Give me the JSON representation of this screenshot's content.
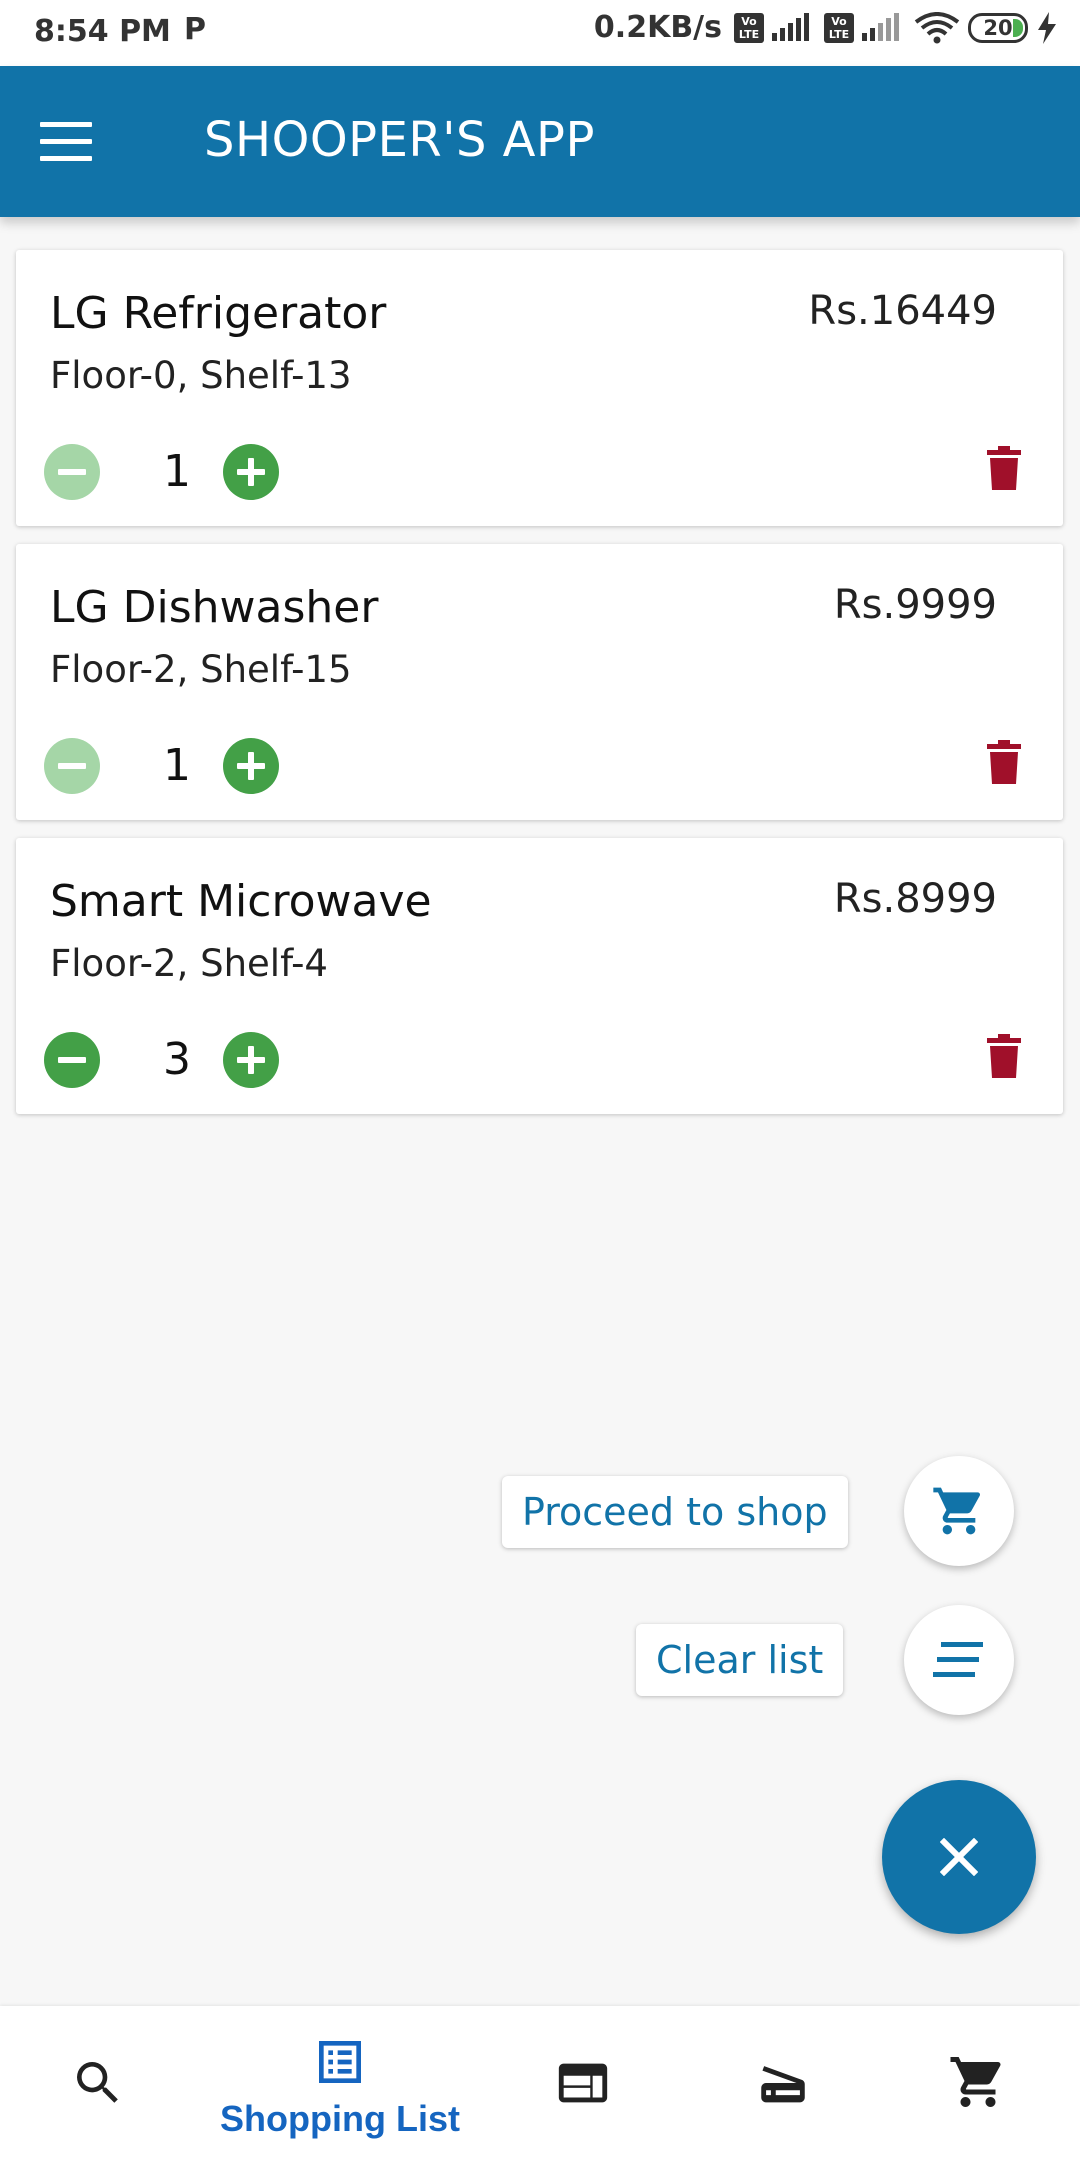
{
  "status_bar": {
    "time": "8:54 PM",
    "notification_icon": "P",
    "net_speed": "0.2KB/s",
    "volte_label_top": "Vo",
    "volte_label_bottom": "LTE",
    "battery": "20"
  },
  "app_bar": {
    "title": "SHOOPER'S APP",
    "menu_icon": "hamburger-menu-icon",
    "color": "#1173a8"
  },
  "items": [
    {
      "name": "LG Refrigerator",
      "location": "Floor-0, Shelf-13",
      "price": "Rs.16449",
      "quantity": "1"
    },
    {
      "name": "LG Dishwasher",
      "location": "Floor-2, Shelf-15",
      "price": "Rs.9999",
      "quantity": "1"
    },
    {
      "name": "Smart Microwave",
      "location": "Floor-2, Shelf-4",
      "price": "Rs.8999",
      "quantity": "3"
    }
  ],
  "fab_menu": {
    "proceed_label": "Proceed to shop",
    "clear_label": "Clear list"
  },
  "bottom_nav": {
    "active_label": "Shopping List",
    "items": [
      "search-icon",
      "list-icon",
      "web-icon",
      "scanner-icon",
      "cart-icon"
    ]
  },
  "colors": {
    "primary": "#1173a8",
    "stepper": "#43a047",
    "stepper_disabled": "#a5d6a7",
    "delete": "#a0102a"
  }
}
